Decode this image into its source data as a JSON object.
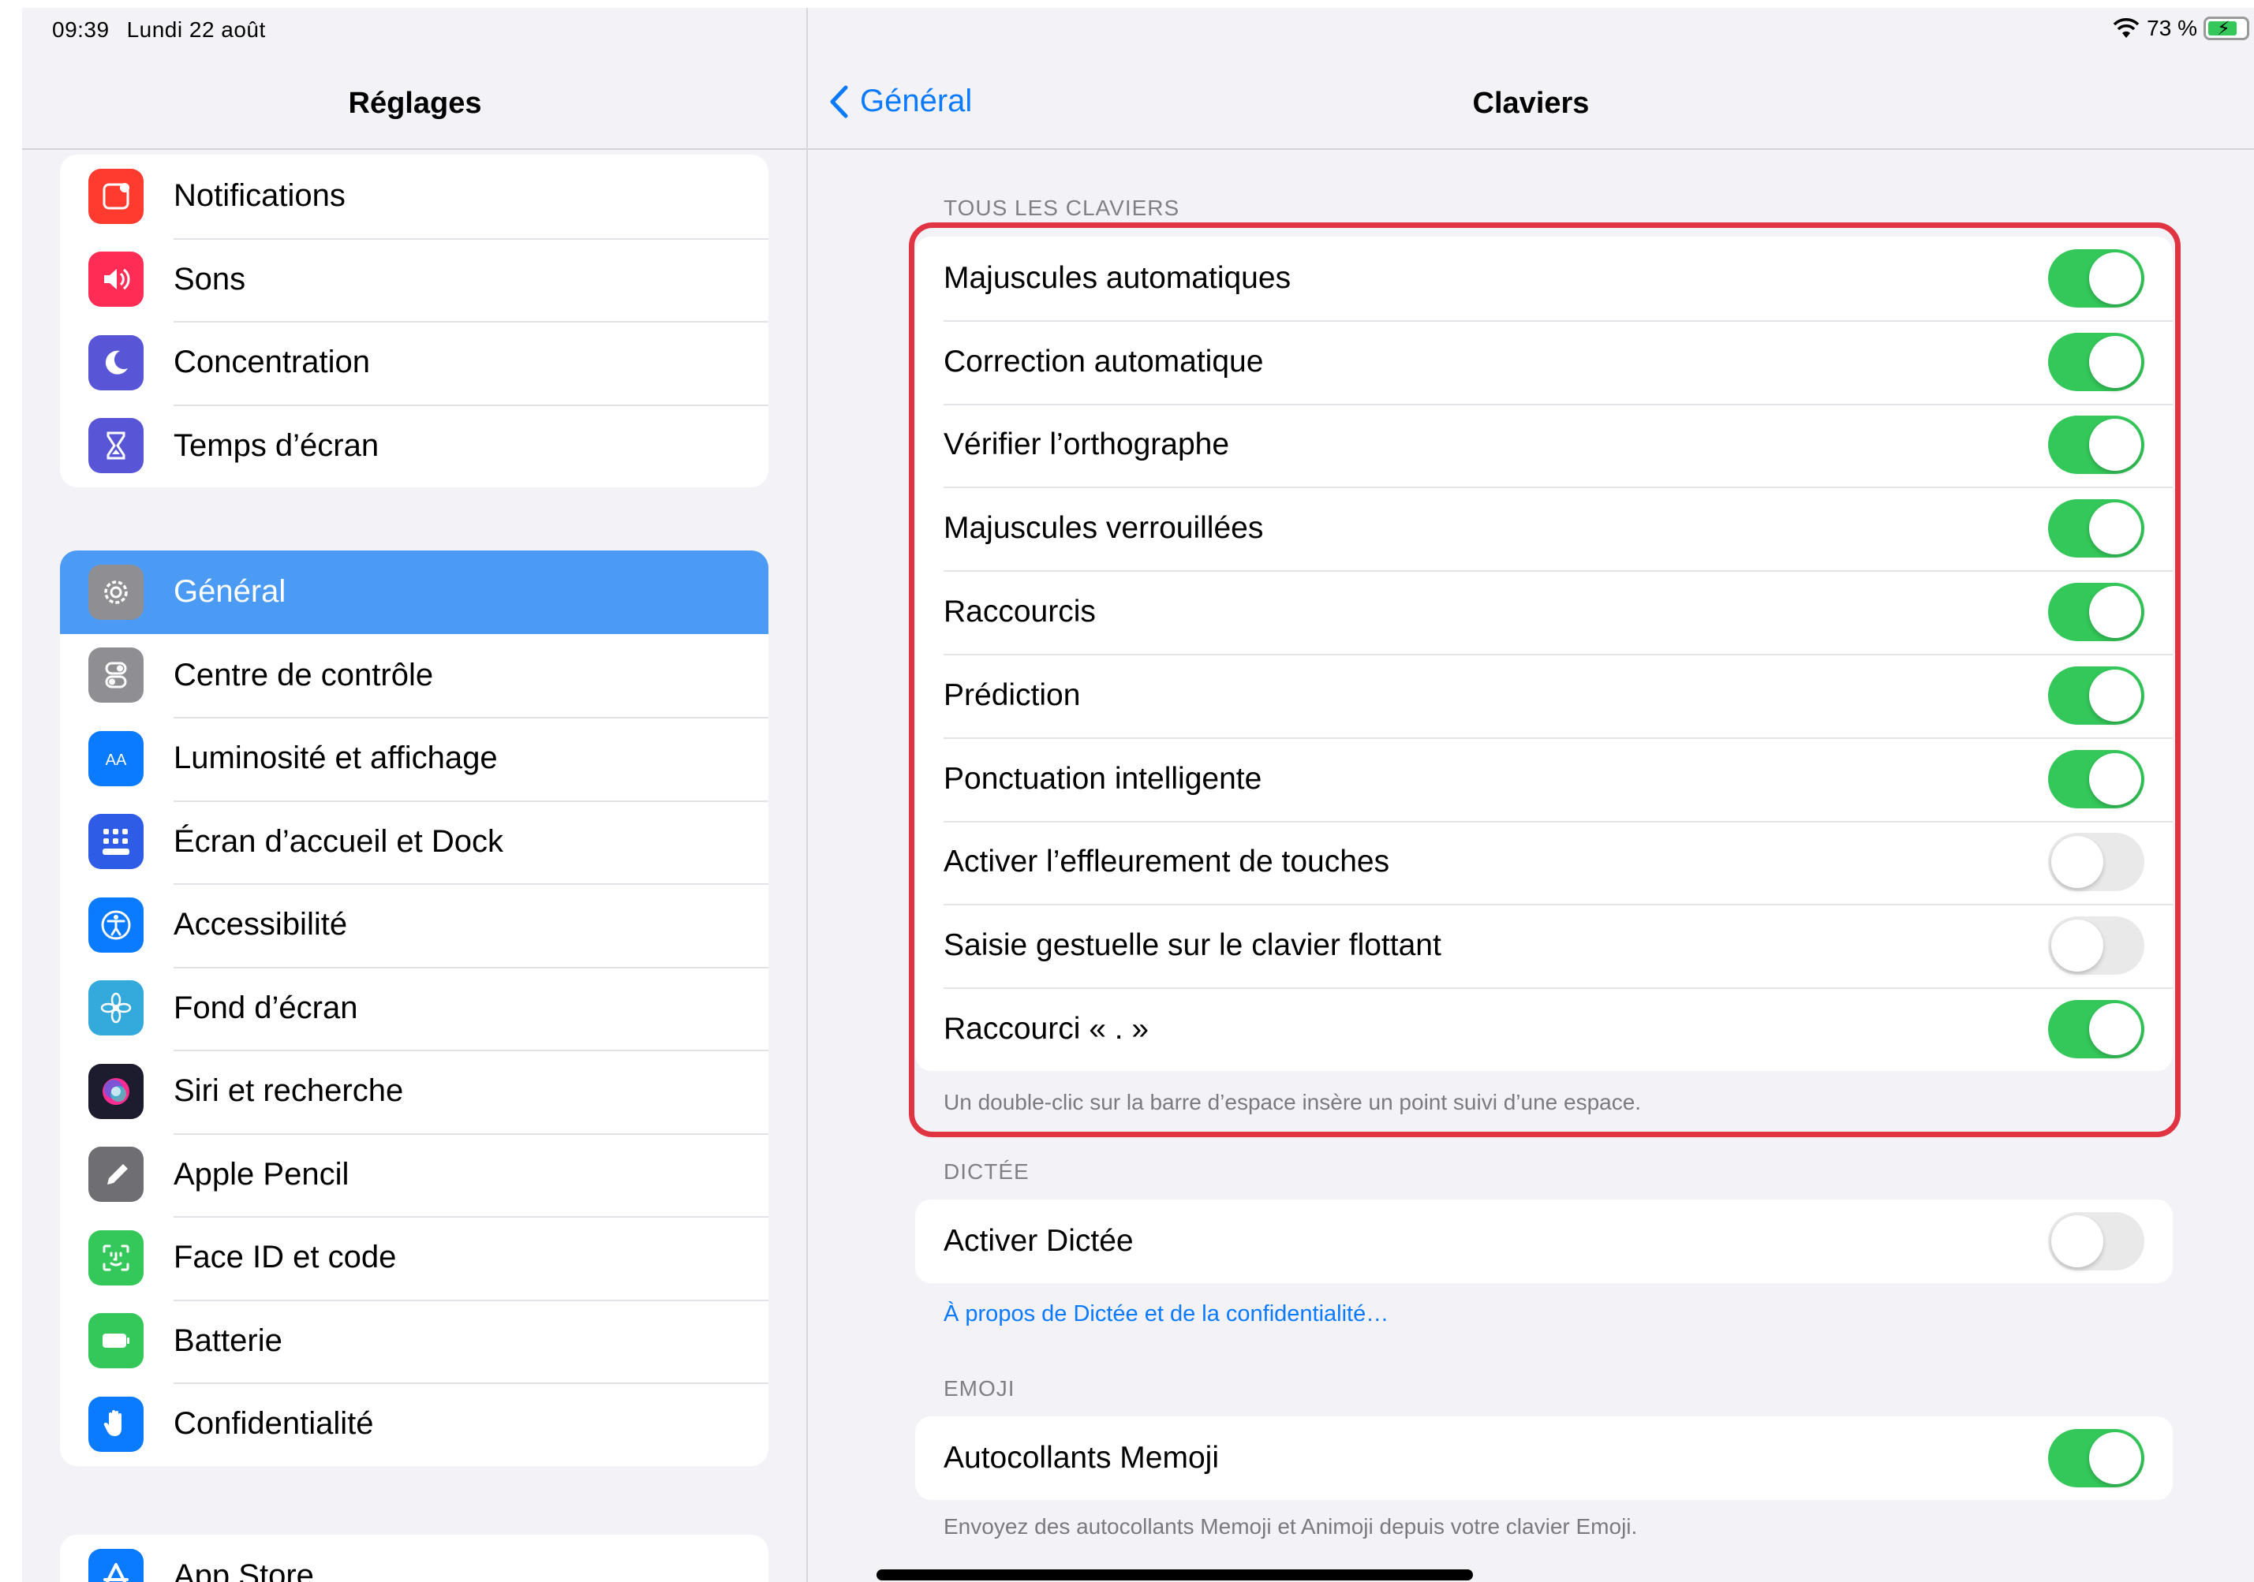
{
  "status_bar": {
    "time": "09:39",
    "date": "Lundi 22 août",
    "battery": "73 %"
  },
  "sidebar": {
    "title": "Réglages",
    "groups": [
      {
        "items": [
          {
            "label": "Notifications",
            "icon": "notifications-icon",
            "color": "#ff3b30"
          },
          {
            "label": "Sons",
            "icon": "sounds-icon",
            "color": "#ff2d55"
          },
          {
            "label": "Concentration",
            "icon": "moon-icon",
            "color": "#5856d6"
          },
          {
            "label": "Temps d’écran",
            "icon": "hourglass-icon",
            "color": "#5856d6"
          }
        ]
      },
      {
        "items": [
          {
            "label": "Général",
            "icon": "gear-icon",
            "color": "#8e8e93",
            "selected": true
          },
          {
            "label": "Centre de contrôle",
            "icon": "toggles-icon",
            "color": "#8e8e93"
          },
          {
            "label": "Luminosité et affichage",
            "icon": "display-icon",
            "color": "#0a7aff"
          },
          {
            "label": "Écran d’accueil et Dock",
            "icon": "home-grid-icon",
            "color": "#2f5ce6"
          },
          {
            "label": "Accessibilité",
            "icon": "accessibility-icon",
            "color": "#0a7aff"
          },
          {
            "label": "Fond d’écran",
            "icon": "flower-icon",
            "color": "#34aadc"
          },
          {
            "label": "Siri et recherche",
            "icon": "siri-icon",
            "color": "#1c1c2e"
          },
          {
            "label": "Apple Pencil",
            "icon": "pencil-icon",
            "color": "#6e6e73"
          },
          {
            "label": "Face ID et code",
            "icon": "faceid-icon",
            "color": "#34c759"
          },
          {
            "label": "Batterie",
            "icon": "battery-icon",
            "color": "#34c759"
          },
          {
            "label": "Confidentialité",
            "icon": "hand-icon",
            "color": "#0a7aff"
          }
        ]
      },
      {
        "items": [
          {
            "label": "App Store",
            "icon": "appstore-icon",
            "color": "#0a7aff"
          }
        ]
      }
    ]
  },
  "detail": {
    "back_label": "Général",
    "title": "Claviers",
    "sections": [
      {
        "header": "TOUS LES CLAVIERS",
        "rows": [
          {
            "label": "Majuscules automatiques",
            "on": true
          },
          {
            "label": "Correction automatique",
            "on": true
          },
          {
            "label": "Vérifier l’orthographe",
            "on": true
          },
          {
            "label": "Majuscules verrouillées",
            "on": true
          },
          {
            "label": "Raccourcis",
            "on": true
          },
          {
            "label": "Prédiction",
            "on": true
          },
          {
            "label": "Ponctuation intelligente",
            "on": true
          },
          {
            "label": "Activer l’effleurement de touches",
            "on": false
          },
          {
            "label": "Saisie gestuelle sur le clavier flottant",
            "on": false
          },
          {
            "label": "Raccourci « . »",
            "on": true
          }
        ],
        "footer": "Un double-clic sur la barre d’espace insère un point suivi d’une espace."
      },
      {
        "header": "DICTÉE",
        "rows": [
          {
            "label": "Activer Dictée",
            "on": false
          }
        ],
        "link": "À propos de Dictée et de la confidentialité…"
      },
      {
        "header": "EMOJI",
        "rows": [
          {
            "label": "Autocollants Memoji",
            "on": true
          }
        ],
        "footer": "Envoyez des autocollants Memoji et Animoji depuis votre clavier Emoji."
      }
    ]
  }
}
